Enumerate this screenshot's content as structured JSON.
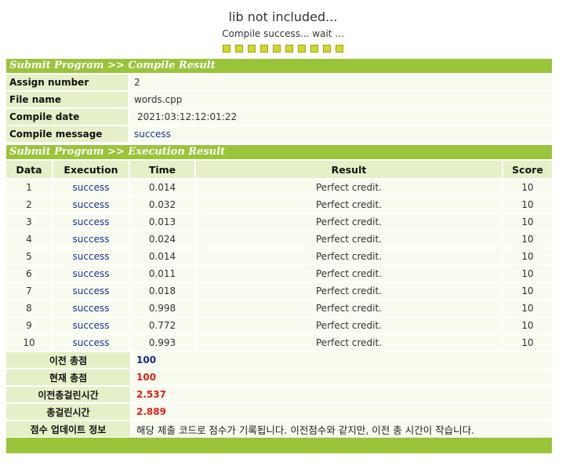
{
  "header": {
    "title": "lib not included...",
    "subtitle": "Compile success... wait ..."
  },
  "progress_dots": 10,
  "colors": {
    "section_bar": "#9ac43a",
    "label_bg": "#e5f0c8",
    "value_bg": "#f8fcef",
    "progress_dot": "#d2d82a",
    "link_blue": "#1c2f9e",
    "score_red": "#e0201a"
  },
  "compile_section": {
    "title": "Submit Program >> Compile Result",
    "rows": [
      {
        "label": "Assign number",
        "value": "2"
      },
      {
        "label": "File name",
        "value": "words.cpp"
      },
      {
        "label": "Compile date",
        "value": "2021:03:12:12:01:22"
      },
      {
        "label": "Compile message",
        "value": "success"
      }
    ]
  },
  "execution_section": {
    "title": "Submit Program >> Execution Result",
    "columns": [
      "Data",
      "Execution",
      "Time",
      "Result",
      "Score"
    ],
    "rows": [
      {
        "data": "1",
        "execution": "success",
        "time": "0.014",
        "result": "Perfect credit.",
        "score": "10"
      },
      {
        "data": "2",
        "execution": "success",
        "time": "0.032",
        "result": "Perfect credit.",
        "score": "10"
      },
      {
        "data": "3",
        "execution": "success",
        "time": "0.013",
        "result": "Perfect credit.",
        "score": "10"
      },
      {
        "data": "4",
        "execution": "success",
        "time": "0.024",
        "result": "Perfect credit.",
        "score": "10"
      },
      {
        "data": "5",
        "execution": "success",
        "time": "0.014",
        "result": "Perfect credit.",
        "score": "10"
      },
      {
        "data": "6",
        "execution": "success",
        "time": "0.011",
        "result": "Perfect credit.",
        "score": "10"
      },
      {
        "data": "7",
        "execution": "success",
        "time": "0.018",
        "result": "Perfect credit.",
        "score": "10"
      },
      {
        "data": "8",
        "execution": "success",
        "time": "0.998",
        "result": "Perfect credit.",
        "score": "10"
      },
      {
        "data": "9",
        "execution": "success",
        "time": "0.772",
        "result": "Perfect credit.",
        "score": "10"
      },
      {
        "data": "10",
        "execution": "success",
        "time": "0.993",
        "result": "Perfect credit.",
        "score": "10"
      }
    ]
  },
  "summary": {
    "previous_total_label": "이전 총점",
    "previous_total": "100",
    "current_total_label": "현재 총점",
    "current_total": "100",
    "previous_time_label": "이전총걸린시간",
    "previous_time": "2.537",
    "total_time_label": "총걸린시간",
    "total_time": "2.889",
    "update_info_label": "점수 업데이트 정보",
    "update_info": "해당 제출 코드로 점수가 기록됩니다. 이전점수와 같지만, 이전 총 시간이 작습니다."
  }
}
